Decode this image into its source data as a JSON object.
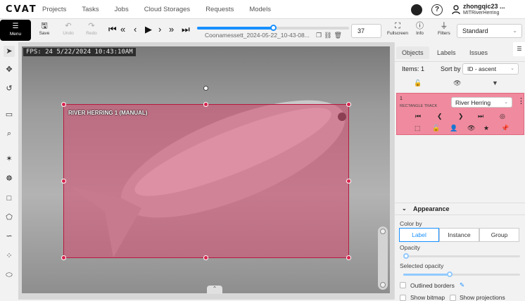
{
  "app": {
    "logo": "CVAT",
    "nav": [
      "Projects",
      "Tasks",
      "Jobs",
      "Cloud Storages",
      "Requests",
      "Models"
    ],
    "user": {
      "name": "zhongqic23 ...",
      "org": "MITRiverHerring"
    }
  },
  "toolbar": {
    "menu_label": "Menu",
    "save_label": "Save",
    "undo_label": "Undo",
    "redo_label": "Redo",
    "filename": "Coonamessett_2024-05-22_10-43-08...",
    "frame_number": "37",
    "frame_progress": 0.5,
    "fullscreen_label": "Fullscreen",
    "info_label": "Info",
    "filters_label": "Filters",
    "workspace": "Standard"
  },
  "canvas": {
    "osd_text": "FPS: 24 5/22/2024 10:43:10AM",
    "bbox_label": "RIVER HERRING 1 (MANUAL)"
  },
  "panel": {
    "tabs": [
      "Objects",
      "Labels",
      "Issues"
    ],
    "items_label": "Items: 1",
    "sort_label": "Sort by",
    "sort_value": "ID - ascent",
    "object": {
      "id": "1",
      "type": "RECTANGLE TRACK",
      "label": "River Herring"
    },
    "appearance": {
      "title": "Appearance",
      "color_by_label": "Color by",
      "color_by_options": [
        "Label",
        "Instance",
        "Group"
      ],
      "color_by_selected": "Label",
      "opacity_label": "Opacity",
      "opacity_value": 0.0,
      "selected_opacity_label": "Selected opacity",
      "selected_opacity_value": 0.4,
      "outlined_borders_label": "Outlined borders",
      "show_bitmap_label": "Show bitmap",
      "show_projections_label": "Show projections"
    }
  },
  "colors": {
    "accent": "#1890ff",
    "object_fill": "#f08a9e",
    "bbox": "#d6486e"
  }
}
